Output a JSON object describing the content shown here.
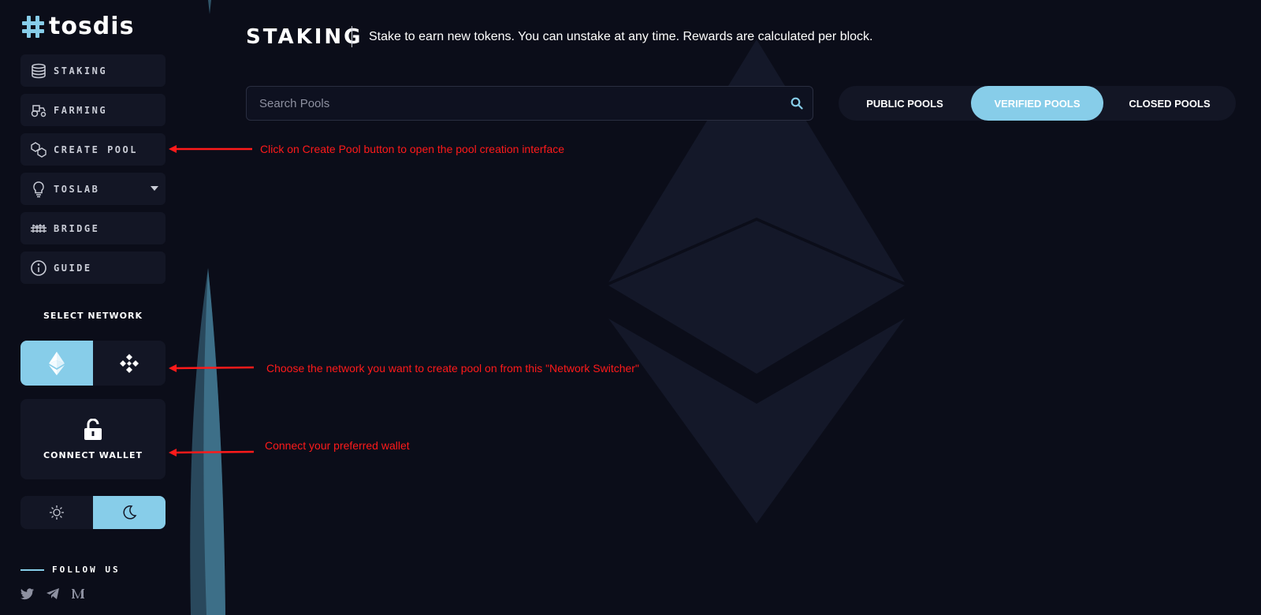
{
  "brand": {
    "name": "tosdis"
  },
  "sidebar": {
    "items": [
      {
        "label": "STAKING",
        "icon": "coins-icon"
      },
      {
        "label": "FARMING",
        "icon": "tractor-icon"
      },
      {
        "label": "CREATE POOL",
        "icon": "cubes-icon"
      },
      {
        "label": "TOSLAB",
        "icon": "lightbulb-icon",
        "has_dropdown": true
      },
      {
        "label": "BRIDGE",
        "icon": "bridge-icon"
      },
      {
        "label": "GUIDE",
        "icon": "info-icon"
      }
    ],
    "network": {
      "title": "SELECT NETWORK",
      "options": [
        {
          "name": "Ethereum",
          "icon": "ethereum-icon",
          "selected": true
        },
        {
          "name": "BNB Chain",
          "icon": "binance-icon",
          "selected": false
        }
      ]
    },
    "wallet": {
      "label": "CONNECT WALLET",
      "icon": "unlock-icon"
    },
    "theme": {
      "options": [
        {
          "name": "light",
          "icon": "sun-icon",
          "selected": false
        },
        {
          "name": "dark",
          "icon": "moon-icon",
          "selected": true
        }
      ]
    },
    "follow": {
      "label": "FOLLOW US",
      "socials": [
        "twitter-icon",
        "telegram-icon",
        "medium-icon"
      ]
    }
  },
  "header": {
    "title": "STAKING",
    "subtitle": "Stake to earn new tokens. You can unstake at any time. Rewards are calculated per block."
  },
  "search": {
    "placeholder": "Search Pools",
    "value": ""
  },
  "pool_tabs": [
    {
      "label": "PUBLIC POOLS",
      "active": false
    },
    {
      "label": "VERIFIED POOLS",
      "active": true
    },
    {
      "label": "CLOSED POOLS",
      "active": false
    }
  ],
  "annotations": {
    "create_pool": "Click on Create Pool button to open the pool creation interface",
    "network": "Choose the network you want to create pool on from this \"Network Switcher\"",
    "wallet": "Connect your preferred wallet"
  },
  "colors": {
    "background": "#0b0d19",
    "panel": "#131625",
    "accent": "#87cde9",
    "annotation": "#ff1a1a"
  }
}
